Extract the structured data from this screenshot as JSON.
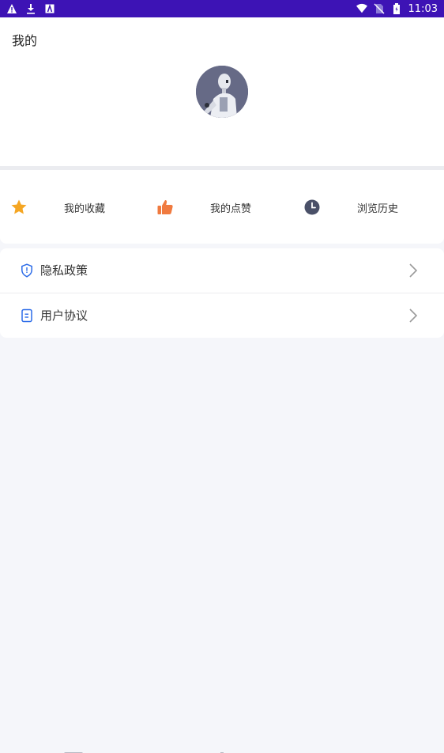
{
  "status_bar": {
    "time": "11:03",
    "icons": [
      "alert-icon",
      "download-icon",
      "a-badge-icon",
      "wifi-icon",
      "no-sim-icon",
      "battery-icon"
    ]
  },
  "header": {
    "title": "我的",
    "avatar_alt": "robot avatar"
  },
  "actions": [
    {
      "label": "我的收藏",
      "icon": "star-icon",
      "color": "#f5a623"
    },
    {
      "label": "我的点赞",
      "icon": "thumbs-up-icon",
      "color": "#f07a3f"
    },
    {
      "label": "浏览历史",
      "icon": "clock-icon",
      "color": "#4a5068"
    }
  ],
  "menu": [
    {
      "label": "隐私政策",
      "icon": "shield-icon"
    },
    {
      "label": "用户协议",
      "icon": "document-icon"
    }
  ],
  "colors": {
    "status_bar": "#3d13b5",
    "accent_blue": "#2b6be8",
    "background": "#f5f6fa"
  }
}
